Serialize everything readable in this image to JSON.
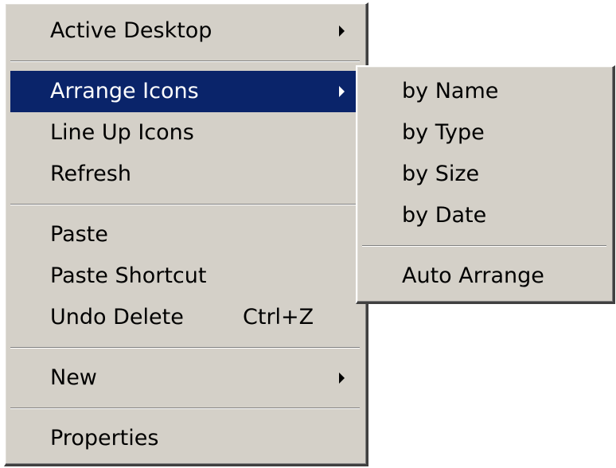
{
  "main_menu": {
    "active_desktop": "Active Desktop",
    "arrange_icons": "Arrange Icons",
    "line_up_icons": "Line Up Icons",
    "refresh": "Refresh",
    "paste": "Paste",
    "paste_shortcut": "Paste Shortcut",
    "undo_delete": "Undo Delete",
    "undo_delete_shortcut": "Ctrl+Z",
    "new": "New",
    "properties": "Properties",
    "selected_item": "Arrange Icons"
  },
  "submenu": {
    "by_name": "by Name",
    "by_type": "by Type",
    "by_size": "by Size",
    "by_date": "by Date",
    "auto_arrange": "Auto Arrange"
  },
  "colors": {
    "menu_background": "#d4d0c8",
    "selection_background": "#0a246a",
    "selection_text": "#ffffff"
  },
  "icons": {
    "submenu_arrow": "chevron-right-icon"
  }
}
